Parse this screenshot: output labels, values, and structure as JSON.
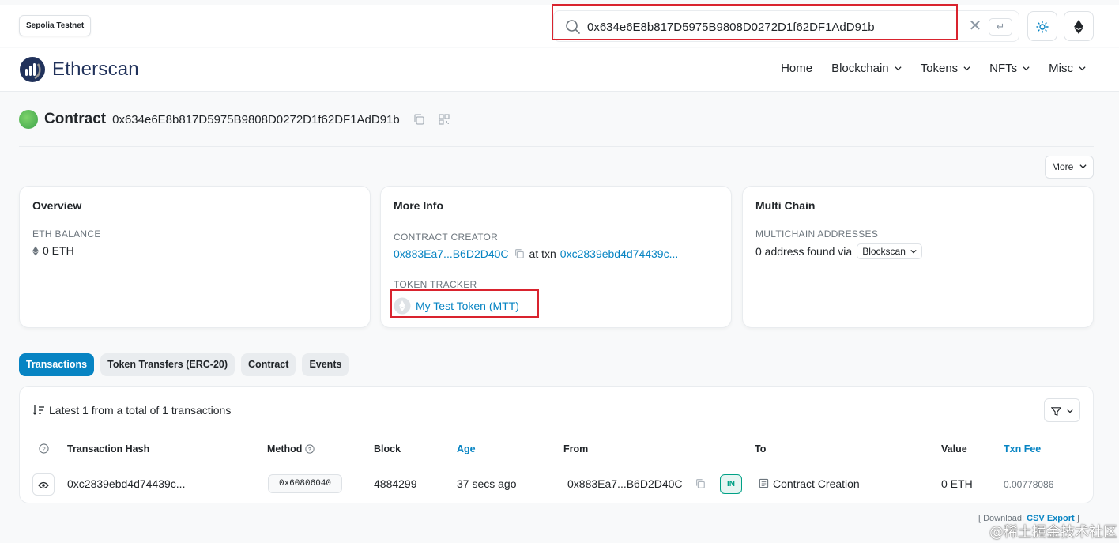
{
  "network_badge": "Sepolia Testnet",
  "search": {
    "value": "0x634e6E8b817D5975B9808D0272D1f62DF1AdD91b",
    "clear": "✕",
    "enter": "↵"
  },
  "brand": {
    "name": "Etherscan"
  },
  "nav": [
    {
      "label": "Home",
      "dropdown": false
    },
    {
      "label": "Blockchain",
      "dropdown": true
    },
    {
      "label": "Tokens",
      "dropdown": true
    },
    {
      "label": "NFTs",
      "dropdown": true
    },
    {
      "label": "Misc",
      "dropdown": true
    }
  ],
  "page": {
    "title": "Contract",
    "address": "0x634e6E8b817D5975B9808D0272D1f62DF1AdD91b",
    "more_label": "More"
  },
  "overview": {
    "title": "Overview",
    "balance_label": "ETH BALANCE",
    "balance_value": "0 ETH"
  },
  "more_info": {
    "title": "More Info",
    "creator_label": "CONTRACT CREATOR",
    "creator_address": "0x883Ea7...B6D2D40C",
    "at_txn": "at txn",
    "creator_txn": "0xc2839ebd4d74439c...",
    "tracker_label": "TOKEN TRACKER",
    "tracker_value": "My Test Token (MTT)"
  },
  "multi_chain": {
    "title": "Multi Chain",
    "label": "MULTICHAIN ADDRESSES",
    "text": "0 address found via",
    "select": "Blockscan"
  },
  "tabs": [
    {
      "label": "Transactions",
      "active": true
    },
    {
      "label": "Token Transfers (ERC-20)",
      "active": false
    },
    {
      "label": "Contract",
      "active": false
    },
    {
      "label": "Events",
      "active": false
    }
  ],
  "table": {
    "summary": "Latest 1 from a total of 1 transactions",
    "headers": {
      "hash": "Transaction Hash",
      "method": "Method",
      "block": "Block",
      "age": "Age",
      "from": "From",
      "to": "To",
      "value": "Value",
      "fee": "Txn Fee"
    },
    "rows": [
      {
        "hash": "0xc2839ebd4d74439c...",
        "method": "0x60806040",
        "block": "4884299",
        "age": "37 secs ago",
        "from": "0x883Ea7...B6D2D40C",
        "direction": "IN",
        "to": "Contract Creation",
        "value": "0 ETH",
        "fee": "0.00778086"
      }
    ]
  },
  "download": {
    "prefix": "[ Download:",
    "link": "CSV Export",
    "suffix": "]"
  },
  "watermark": "@稀土掘金技术社区",
  "colors": {
    "link": "#0784c3",
    "active_tab": "#0784c3",
    "highlight": "#d9232e",
    "in_badge": "#00a186"
  }
}
